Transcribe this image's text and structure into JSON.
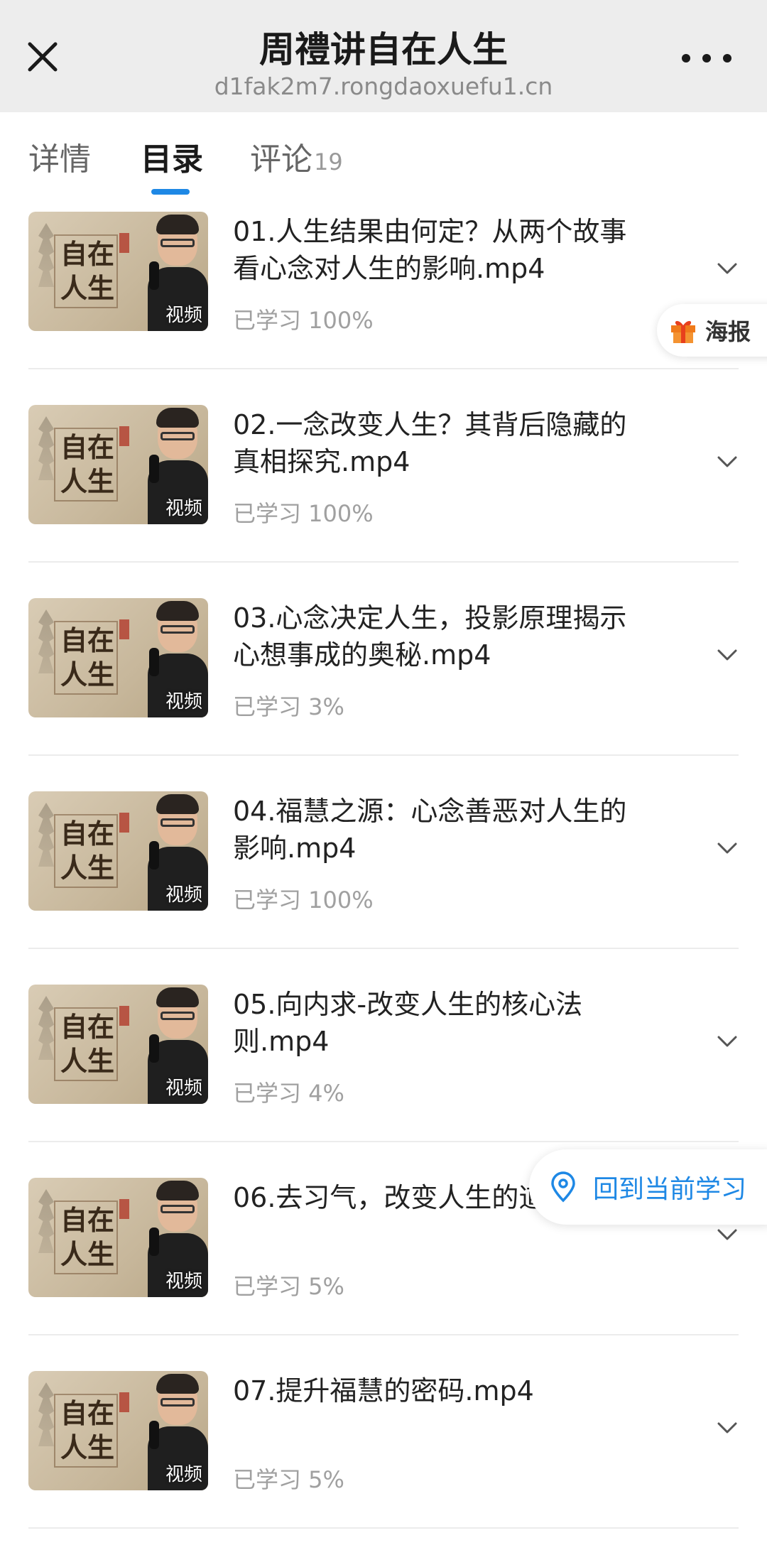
{
  "header": {
    "title": "周禮讲自在人生",
    "url": "d1fak2m7.rongdaoxuefu1.cn",
    "close_icon": "close-icon",
    "more_icon": "more-icon"
  },
  "tabs": [
    {
      "label": "详情",
      "count": ""
    },
    {
      "label": "目录",
      "count": "",
      "active": true
    },
    {
      "label": "评论",
      "count": "19"
    }
  ],
  "accent_color": "#1e88e5",
  "thumbnail": {
    "calligraphy_line1": "自在",
    "calligraphy_line2": "人生",
    "badge": "视频"
  },
  "items": [
    {
      "title": "01.人生结果由何定？从两个故事看心念对人生的影响.mp4",
      "progress": "已学习 100%"
    },
    {
      "title": "02.一念改变人生？其背后隐藏的真相探究.mp4",
      "progress": "已学习 100%"
    },
    {
      "title": "03.心念决定人生，投影原理揭示心想事成的奥秘.mp4",
      "progress": "已学习 3%"
    },
    {
      "title": "04.福慧之源：心念善恶对人生的影响.mp4",
      "progress": "已学习 100%"
    },
    {
      "title": "05.向内求-改变人生的核心法则.mp4",
      "progress": "已学习 4%"
    },
    {
      "title": "06.去习气，改变人生的道.mp4",
      "progress": "已学习 5%"
    },
    {
      "title": "07.提升福慧的密码.mp4",
      "progress": "已学习 5%"
    }
  ],
  "floating": {
    "poster_label": "海报",
    "resume_label": "回到当前学习"
  }
}
